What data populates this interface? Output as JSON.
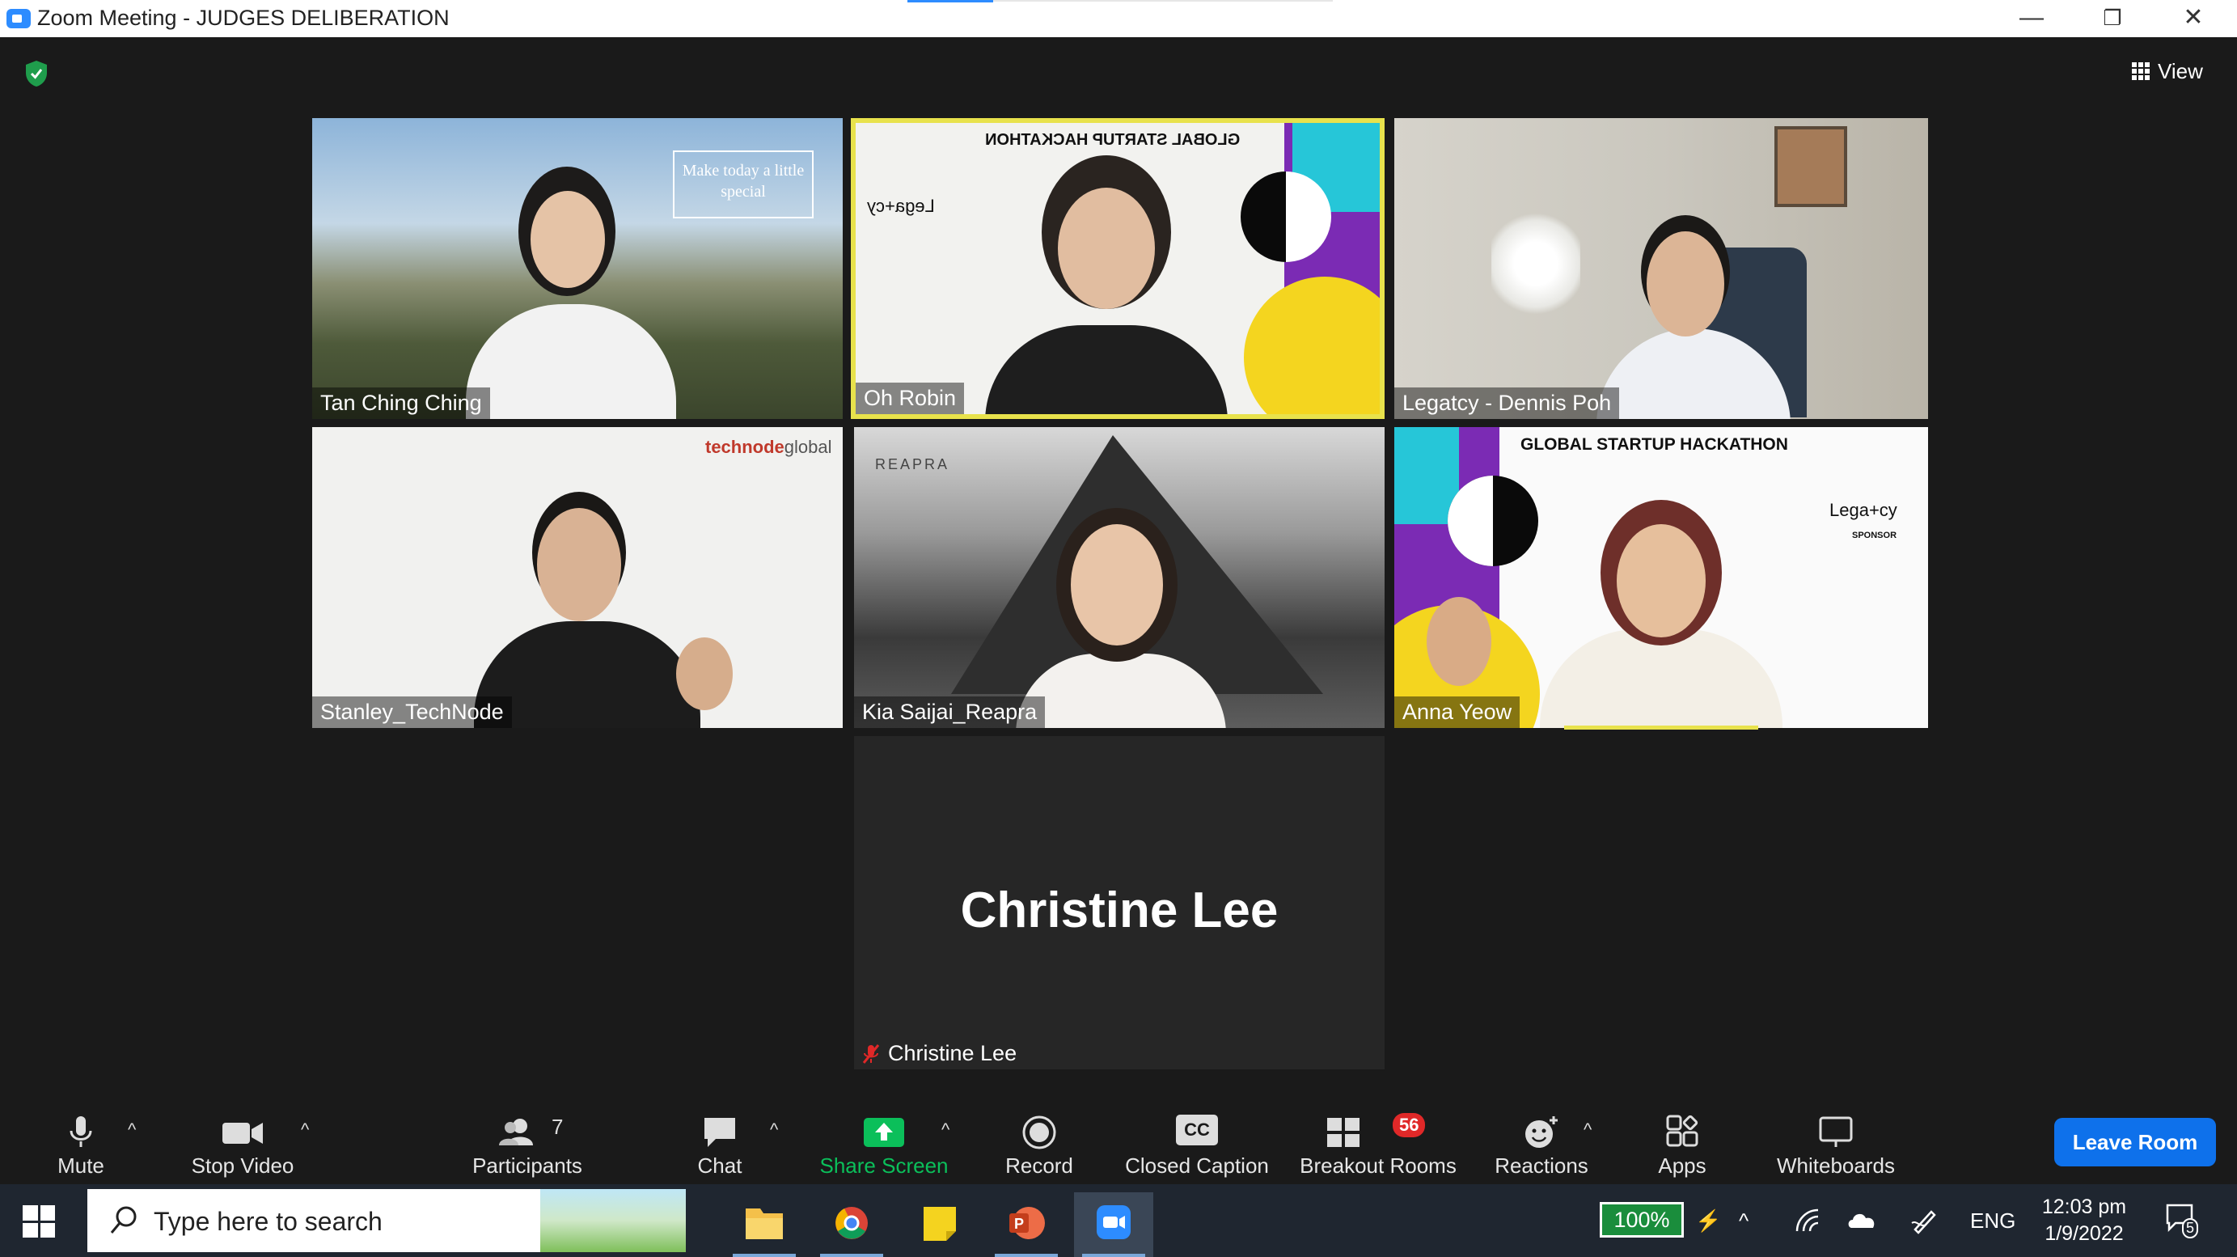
{
  "window": {
    "title": "Zoom Meeting - JUDGES DELIBERATION",
    "minimize": "—",
    "maximize": "❐",
    "close": "✕"
  },
  "meeting": {
    "view_label": "View",
    "tiles": [
      {
        "name": "Tan Ching Ching",
        "card_text": "Make today a little special"
      },
      {
        "name": "Oh Robin",
        "banner": "GLOBAL STARTUP HACKATHON",
        "logo": "Lega+cy"
      },
      {
        "name": "Legatcy - Dennis Poh"
      },
      {
        "name": "Stanley_TechNode",
        "brand": "technode",
        "brand_suffix": "global"
      },
      {
        "name": "Kia Saijai_Reapra",
        "brand": "REAPRA"
      },
      {
        "name": "Anna Yeow",
        "banner": "GLOBAL STARTUP HACKATHON",
        "logo": "Lega+cy",
        "sponsor": "SPONSOR"
      }
    ],
    "video_off": {
      "display_name": "Christine Lee",
      "label": "Christine Lee"
    }
  },
  "toolbar": {
    "mute": "Mute",
    "stop_video": "Stop Video",
    "participants": "Participants",
    "participants_count": "7",
    "chat": "Chat",
    "share_screen": "Share Screen",
    "record": "Record",
    "closed_caption": "Closed Caption",
    "cc_icon": "CC",
    "breakout_rooms": "Breakout Rooms",
    "breakout_badge": "56",
    "reactions": "Reactions",
    "apps": "Apps",
    "whiteboards": "Whiteboards",
    "leave": "Leave Room"
  },
  "taskbar": {
    "search_placeholder": "Type here to search",
    "battery": "100%",
    "language": "ENG",
    "time": "12:03 pm",
    "date": "1/9/2022",
    "notifications": "5"
  },
  "colors": {
    "accent": "#0e71eb",
    "share_green": "#0bbf5a",
    "active_speaker": "#e8e24c",
    "badge_red": "#e02828"
  }
}
